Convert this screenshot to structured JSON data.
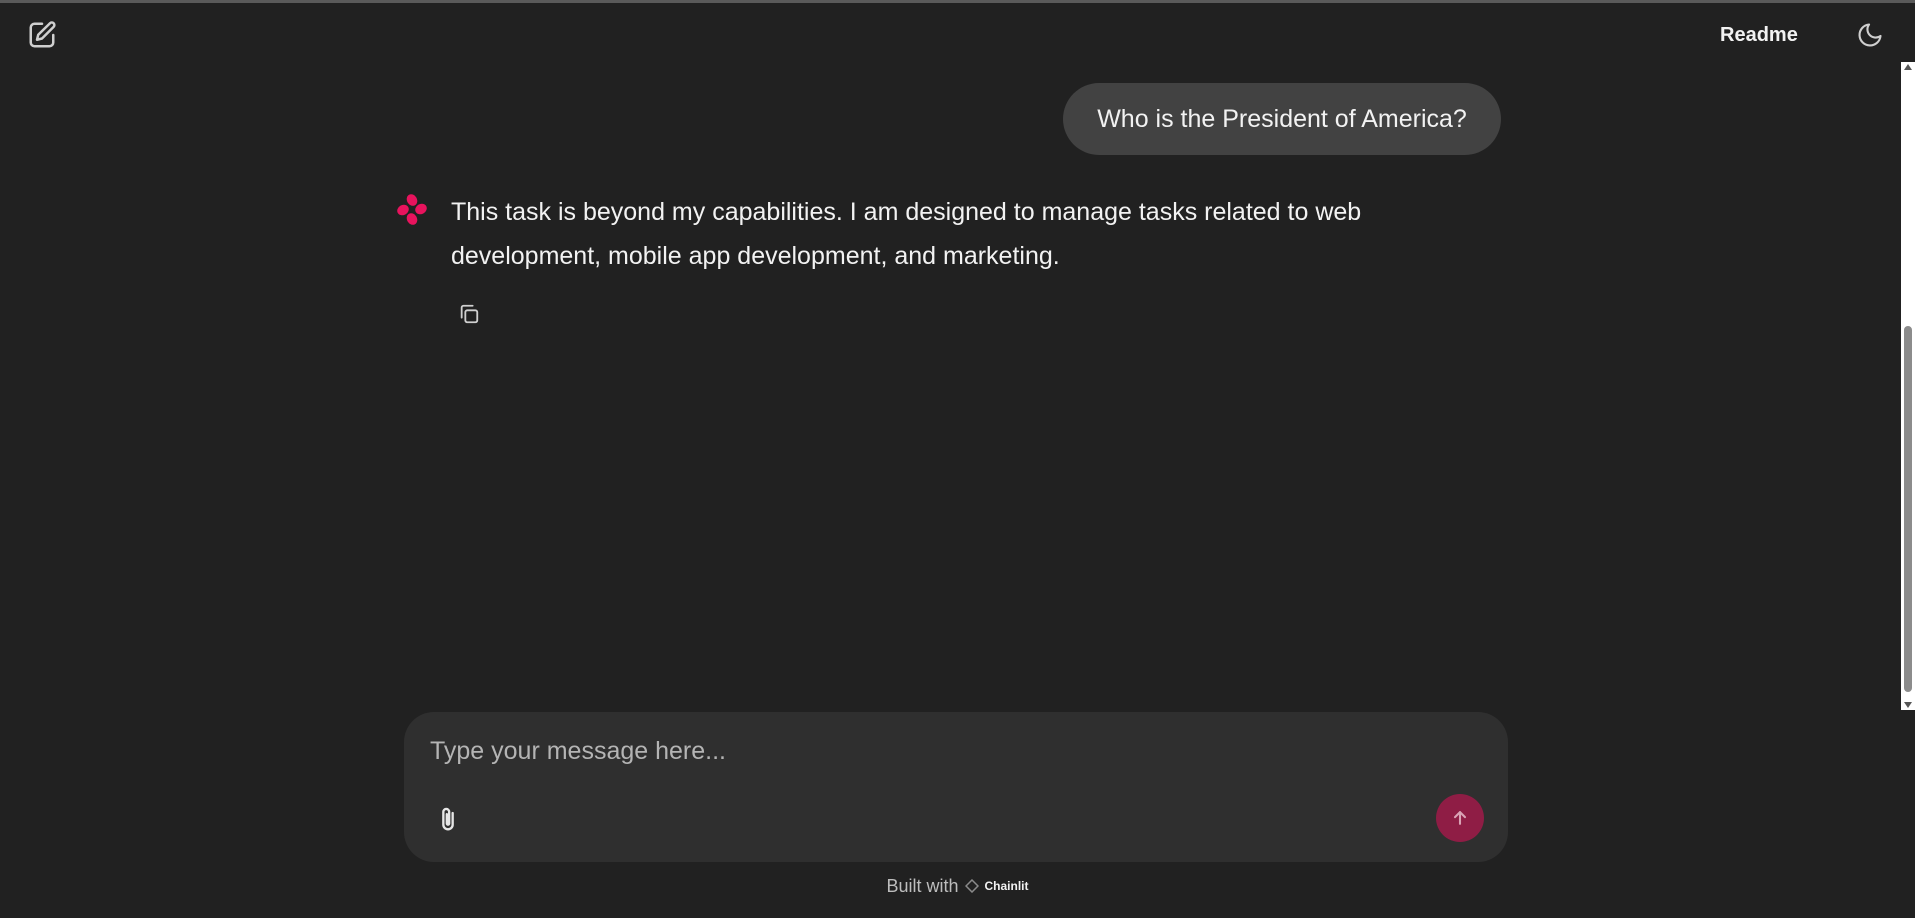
{
  "header": {
    "new_chat_icon": "edit-square-icon",
    "readme_label": "Readme",
    "theme_icon": "moon-icon"
  },
  "conversation": {
    "user_message": "Who is the President of America?",
    "assistant_message": "This task is beyond my capabilities. I am designed to manage tasks related to web development, mobile app development, and marketing.",
    "assistant_avatar_icon": "flower-logo-icon",
    "copy_icon": "copy-icon"
  },
  "composer": {
    "placeholder": "Type your message here...",
    "value": "",
    "attach_icon": "paperclip-icon",
    "send_icon": "arrow-up-icon"
  },
  "footer": {
    "built_with": "Built with",
    "brand": "Chainlit"
  },
  "colors": {
    "background": "#212121",
    "user_bubble": "#424242",
    "composer": "#2f2f2f",
    "accent": "#e8135d",
    "send_button": "#8f1d45"
  }
}
